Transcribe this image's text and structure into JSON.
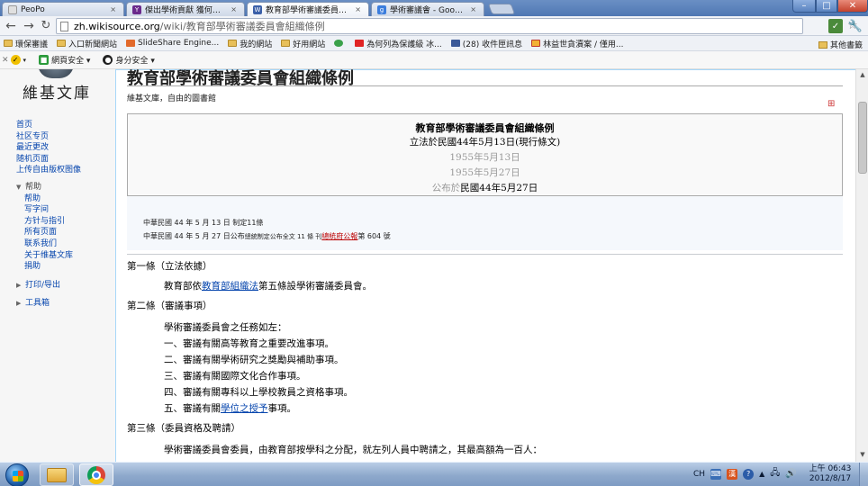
{
  "browser": {
    "tabs": [
      {
        "label": "PeoPo",
        "active": false
      },
      {
        "label": "傑出學術貢獻 獲何任大學教",
        "active": false
      },
      {
        "label": "教育部學術審議委員會組織",
        "active": true
      },
      {
        "label": "學術審議會 - Google 搜尋",
        "active": false
      }
    ],
    "close_glyph": "×",
    "url_host": "zh.wikisource.org",
    "url_path": "/wiki/教育部學術審議委員會組織條例",
    "bookmarks": [
      {
        "label": "環保審議",
        "icon": "folder-icon"
      },
      {
        "label": "入口新聞網站",
        "icon": "folder-icon"
      },
      {
        "label": "SlideShare Engine...",
        "icon": "slideshare-icon"
      },
      {
        "label": "我的網站",
        "icon": "folder-icon"
      },
      {
        "label": "好用網站",
        "icon": "folder-icon"
      },
      {
        "label": "",
        "icon": "chrome-green-icon"
      },
      {
        "label": "為何列為保護級 冰...",
        "icon": "youtube-icon"
      },
      {
        "label": "(28) 收件匣訊息",
        "icon": "facebook-icon"
      },
      {
        "label": "林益世貪瀆案 / 僅用...",
        "icon": "gmail-icon"
      }
    ],
    "other_bookmarks": "其他書籤",
    "norton": [
      {
        "label": "網頁安全 ▾"
      },
      {
        "label": "身分安全 ▾"
      }
    ]
  },
  "site": {
    "logo_text": "維基文庫"
  },
  "sidebar": {
    "links": [
      "首页",
      "社区专页",
      "最近更改",
      "随机页面",
      "上传自由版权图像"
    ],
    "help_section": "帮助",
    "help_links": [
      "帮助",
      "写字间",
      "方针与指引",
      "所有页面",
      "联系我们",
      "关于维基文库",
      "捐助"
    ],
    "print_section": "打印/导出",
    "tools_section": "工具箱"
  },
  "page": {
    "title": "教育部學術審議委員會組織條例",
    "tagline": "維基文庫，自由的圖書館",
    "header": {
      "title": "教育部學術審議委員會組織條例",
      "line1": "立法於民國44年5月13日(現行條文)",
      "line2": "1955年5月13日",
      "line3": "1955年5月27日",
      "line4_prefix": "公布於",
      "line4": "民國44年5月27日"
    },
    "history": {
      "line1": "中華民國 44 年 5 月 13 日 制定11條",
      "line2_pre": "中華民國 44 年 5 月 27 日公布",
      "line2_small": "總統制定公布全文 11 條 刊",
      "line2_red": "總統府公報",
      "line2_post": "第 604 號"
    },
    "articles": [
      {
        "head": "第一條（立法依據）",
        "lines": [
          {
            "pre": "教育部依",
            "link": "教育部組織法",
            "post": "第五條設學術審議委員會。"
          }
        ]
      },
      {
        "head": "第二條（審議事項）",
        "lines": [
          {
            "pre": "學術審議委員會之任務如左：",
            "link": "",
            "post": ""
          },
          {
            "pre": "一、審議有關高等教育之重要改進事項。",
            "link": "",
            "post": ""
          },
          {
            "pre": "二、審議有關學術研究之獎勵與補助事項。",
            "link": "",
            "post": ""
          },
          {
            "pre": "三、審議有關國際文化合作事項。",
            "link": "",
            "post": ""
          },
          {
            "pre": "四、審議有關專科以上學校教員之資格事項。",
            "link": "",
            "post": ""
          },
          {
            "pre": "五、審議有關",
            "link": "學位之授予",
            "post": "事項。"
          }
        ]
      },
      {
        "head": "第三條（委員資格及聘請）",
        "lines": [
          {
            "pre": "學術審議委員會委員，由教育部按學科之分配，就左列人員中聘請之，其最高額為一百人：",
            "link": "",
            "post": ""
          }
        ]
      }
    ]
  },
  "taskbar": {
    "ime": "CH",
    "clock_time": "上午 06:43",
    "clock_date": "2012/8/17"
  },
  "colors": {
    "link": "#0645ad",
    "redlink": "#ba0000",
    "taskbar": "#8ea9cc",
    "tabstrip": "#4f77b3"
  }
}
